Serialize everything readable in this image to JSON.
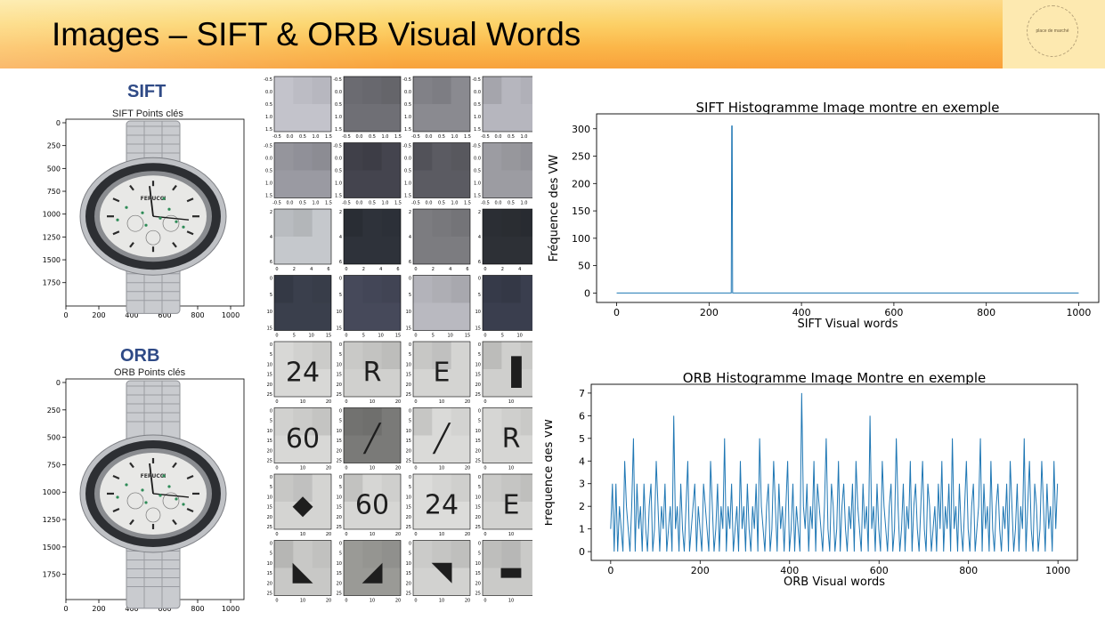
{
  "header": {
    "title": "Images – SIFT & ORB Visual Words",
    "logo_text": "place de marché"
  },
  "sift": {
    "label": "SIFT",
    "image_title": "SIFT Points clés",
    "y_ticks": [
      "0",
      "250",
      "500",
      "750",
      "1000",
      "1250",
      "1500",
      "1750"
    ],
    "x_ticks": [
      "0",
      "200",
      "400",
      "600",
      "800",
      "1000"
    ]
  },
  "orb": {
    "label": "ORB",
    "image_title": "ORB Points clés",
    "y_ticks": [
      "0",
      "250",
      "500",
      "750",
      "1000",
      "1250",
      "1500",
      "1750"
    ],
    "x_ticks": [
      "0",
      "200",
      "400",
      "600",
      "800",
      "1000"
    ]
  },
  "watch": {
    "brand": "FERUCCI"
  },
  "patches": {
    "rows": [
      {
        "x_ticks": [
          "-0.5",
          "0.0",
          "0.5",
          "1.0",
          "1.5"
        ],
        "y_ticks": [
          "-0.5",
          "0.0",
          "0.5",
          "1.0",
          "1.5"
        ],
        "tones": [
          "#c3c3cb",
          "#6f6f75",
          "#8a8a90",
          "#b6b6be"
        ]
      },
      {
        "x_ticks": [
          "-0.5",
          "0.0",
          "0.5",
          "1.0",
          "1.5"
        ],
        "y_ticks": [
          "-0.5",
          "0.0",
          "0.5",
          "1.0",
          "1.5"
        ],
        "tones": [
          "#9a9aa2",
          "#44444e",
          "#5b5b62",
          "#9c9ca2"
        ]
      },
      {
        "x_ticks": [
          "0",
          "2",
          "4",
          "6"
        ],
        "y_ticks": [
          "2",
          "4",
          "6"
        ],
        "tones": [
          "#c5c8cc",
          "#2e323a",
          "#7c7c80",
          "#2d3036"
        ]
      },
      {
        "x_ticks": [
          "0",
          "5",
          "10",
          "15"
        ],
        "y_ticks": [
          "0",
          "5",
          "10",
          "15"
        ],
        "tones": [
          "#3a3f4c",
          "#46495a",
          "#b9b9c0",
          "#3a3e4e"
        ]
      },
      {
        "x_ticks": [
          "0",
          "10",
          "20"
        ],
        "y_ticks": [
          "0",
          "5",
          "10",
          "15",
          "20",
          "25"
        ],
        "tones": [
          "#d8d8d6",
          "#d0d0ce",
          "#d4d4d2",
          "#cfcfcd"
        ],
        "glyphs": [
          "24",
          "R",
          "E",
          "▐"
        ]
      },
      {
        "x_ticks": [
          "0",
          "10",
          "20"
        ],
        "y_ticks": [
          "0",
          "5",
          "10",
          "15",
          "20",
          "25"
        ],
        "tones": [
          "#d8d8d6",
          "#7a7a78",
          "#dadad8",
          "#d6d6d4"
        ],
        "glyphs": [
          "60",
          "╱",
          "╱",
          "R"
        ]
      },
      {
        "x_ticks": [
          "0",
          "10",
          "20"
        ],
        "y_ticks": [
          "0",
          "5",
          "10",
          "15",
          "20",
          "25"
        ],
        "tones": [
          "#d4d4d2",
          "#d6d6d4",
          "#dcdcda",
          "#d2d2d0"
        ],
        "glyphs": [
          "◆",
          "60",
          "24",
          "E"
        ]
      },
      {
        "x_ticks": [
          "0",
          "10",
          "20"
        ],
        "y_ticks": [
          "0",
          "5",
          "10",
          "15",
          "20",
          "25"
        ],
        "tones": [
          "#c8c8c6",
          "#9a9a96",
          "#d2d2d0",
          "#cacac8"
        ],
        "glyphs": [
          "◣",
          "◢",
          "◥",
          "▬"
        ]
      }
    ]
  },
  "chart_data": [
    {
      "type": "line",
      "title": "SIFT Histogramme Image montre en exemple",
      "xlabel": "SIFT Visual words",
      "ylabel": "Fréquence des VW",
      "xlim": [
        0,
        1000
      ],
      "ylim": [
        0,
        310
      ],
      "x_ticks": [
        "0",
        "200",
        "400",
        "600",
        "800",
        "1000"
      ],
      "y_ticks": [
        "0",
        "50",
        "100",
        "150",
        "200",
        "250",
        "300"
      ],
      "series": [
        {
          "color": "#1f77b4",
          "x": [
            0,
            248,
            249,
            250,
            251,
            252,
            1000
          ],
          "y": [
            0,
            0,
            305,
            305,
            0,
            0,
            0
          ]
        }
      ]
    },
    {
      "type": "line",
      "title": "ORB Histogramme Image Montre en exemple",
      "xlabel": "ORB Visual words",
      "ylabel": "Fréquence des VW",
      "xlim": [
        0,
        1000
      ],
      "ylim": [
        0,
        7
      ],
      "x_ticks": [
        "0",
        "200",
        "400",
        "600",
        "800",
        "1000"
      ],
      "y_ticks": [
        "0",
        "1",
        "2",
        "3",
        "4",
        "5",
        "6",
        "7"
      ],
      "series": [
        {
          "color": "#1f77b4",
          "x_range": [
            0,
            999
          ],
          "values": [
            1,
            3,
            0,
            3,
            0,
            2,
            1,
            0,
            4,
            2,
            1,
            0,
            2,
            5,
            0,
            3,
            1,
            2,
            0,
            3,
            1,
            0,
            2,
            3,
            0,
            1,
            4,
            2,
            0,
            2,
            1,
            3,
            0,
            1,
            2,
            0,
            6,
            1,
            2,
            0,
            3,
            1,
            0,
            2,
            4,
            0,
            1,
            2,
            3,
            0,
            2,
            1,
            0,
            3,
            2,
            1,
            0,
            4,
            2,
            0,
            1,
            3,
            0,
            2,
            1,
            5,
            0,
            2,
            1,
            3,
            0,
            1,
            2,
            0,
            4,
            1,
            2,
            0,
            3,
            1,
            0,
            2,
            1,
            3,
            0,
            5,
            2,
            1,
            0,
            2,
            3,
            0,
            1,
            4,
            2,
            0,
            3,
            1,
            2,
            0,
            2,
            4,
            0,
            1,
            3,
            0,
            2,
            1,
            0,
            7,
            2,
            1,
            3,
            0,
            2,
            1,
            4,
            0,
            3,
            2,
            1,
            0,
            2,
            5,
            1,
            0,
            3,
            2,
            0,
            1,
            4,
            0,
            2,
            3,
            1,
            0,
            2,
            1,
            3,
            0,
            4,
            2,
            1,
            0,
            3,
            1,
            2,
            0,
            6,
            1,
            2,
            0,
            3,
            1,
            0,
            4,
            2,
            1,
            0,
            2,
            3,
            0,
            1,
            5,
            2,
            0,
            1,
            3,
            0,
            2,
            1,
            4,
            0,
            2,
            3,
            1,
            0,
            2,
            4,
            1,
            0,
            3,
            2,
            0,
            1,
            2,
            0,
            3,
            1,
            4,
            0,
            2,
            1,
            3,
            0,
            5,
            1,
            2,
            0,
            3,
            1,
            0,
            2,
            4,
            1,
            0,
            2,
            3,
            0,
            1,
            2,
            5,
            0,
            3,
            1,
            2,
            0,
            4,
            1,
            0,
            2,
            3,
            1,
            0,
            2,
            1,
            3,
            0,
            4,
            2,
            0,
            1,
            3,
            0,
            2,
            1,
            5,
            0,
            2,
            4,
            1,
            0,
            3,
            2,
            0,
            1,
            4,
            2,
            0,
            3,
            1,
            2,
            0,
            4,
            1,
            3
          ]
        }
      ]
    }
  ]
}
